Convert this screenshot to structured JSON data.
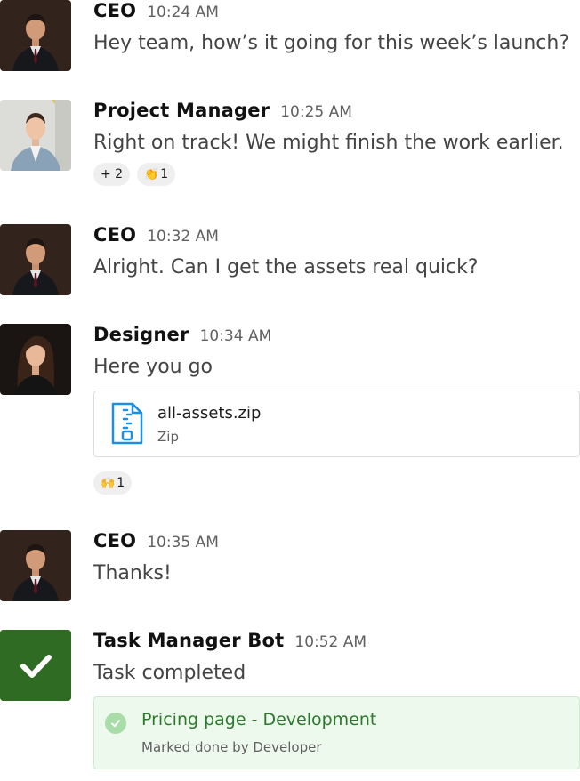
{
  "messages": [
    {
      "author": "CEO",
      "time": "10:24 AM",
      "text": "Hey team, how’s it going for this week’s launch?"
    },
    {
      "author": "Project Manager",
      "time": "10:25 AM",
      "text": "Right on track! We might finish the work earlier.",
      "reactions": [
        {
          "emoji": "",
          "label": "+ 2"
        },
        {
          "emoji": "👏",
          "label": "1"
        }
      ]
    },
    {
      "author": "CEO",
      "time": "10:32 AM",
      "text": "Alright. Can I get the assets real quick?"
    },
    {
      "author": "Designer",
      "time": "10:34 AM",
      "text": "Here you go",
      "attachment": {
        "name": "all-assets.zip",
        "type": "Zip",
        "icon": "zip-file-icon"
      },
      "reactions": [
        {
          "emoji": "🙌",
          "label": "1"
        }
      ]
    },
    {
      "author": "CEO",
      "time": "10:35 AM",
      "text": "Thanks!"
    },
    {
      "author": "Task Manager Bot",
      "time": "10:52 AM",
      "text": "Task completed",
      "task": {
        "title": "Pricing page - Development",
        "subtitle": "Marked done by Developer",
        "icon": "check-circle-icon"
      }
    }
  ],
  "colors": {
    "bot_avatar": "#2f6b22",
    "task_bg": "#eef9ee",
    "task_title": "#2b7a2b",
    "timestamp": "#616061",
    "file_icon": "#1a8fe3"
  }
}
